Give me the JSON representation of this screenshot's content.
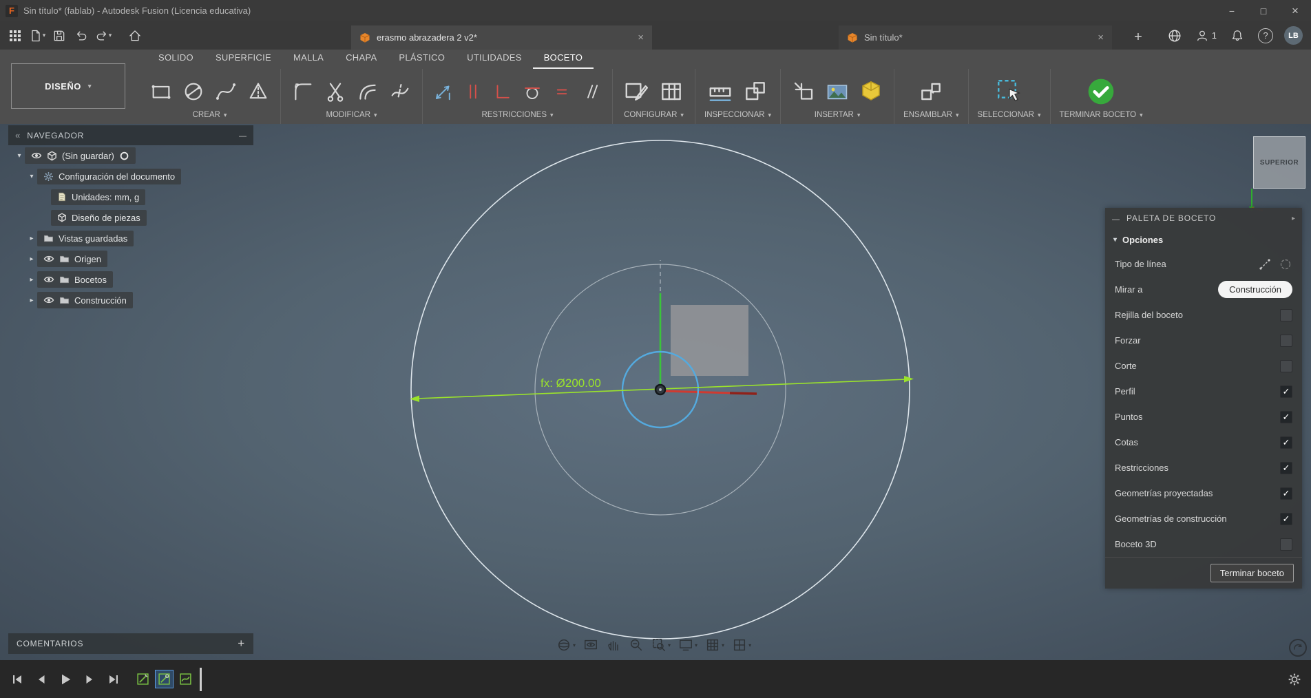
{
  "title_bar": {
    "logo_letter": "F",
    "title": "Sin título* (fablab) - Autodesk Fusion (Licencia educativa)"
  },
  "toolbar": {
    "document_tabs": [
      {
        "label": "erasmo abrazadera 2 v2*",
        "active": true
      },
      {
        "label": "Sin título*",
        "active": false
      }
    ],
    "notification_count": "1",
    "avatar_initials": "LB"
  },
  "ribbon": {
    "workspace_label": "DISEÑO",
    "tabs": [
      {
        "label": "SOLIDO",
        "active": false
      },
      {
        "label": "SUPERFICIE",
        "active": false
      },
      {
        "label": "MALLA",
        "active": false
      },
      {
        "label": "CHAPA",
        "active": false
      },
      {
        "label": "PLÁSTICO",
        "active": false
      },
      {
        "label": "UTILIDADES",
        "active": false
      },
      {
        "label": "BOCETO",
        "active": true
      }
    ],
    "groups": [
      {
        "label": "CREAR"
      },
      {
        "label": "MODIFICAR"
      },
      {
        "label": "RESTRICCIONES"
      },
      {
        "label": "CONFIGURAR"
      },
      {
        "label": "INSPECCIONAR"
      },
      {
        "label": "INSERTAR"
      },
      {
        "label": "ENSAMBLAR"
      },
      {
        "label": "SELECCIONAR"
      },
      {
        "label": "TERMINAR BOCETO"
      }
    ]
  },
  "navigator": {
    "header": "NAVEGADOR",
    "items": [
      {
        "label": "(Sin guardar)"
      },
      {
        "label": "Configuración del documento"
      },
      {
        "label": "Unidades: mm, g"
      },
      {
        "label": "Diseño de piezas"
      },
      {
        "label": "Vistas guardadas"
      },
      {
        "label": "Origen"
      },
      {
        "label": "Bocetos"
      },
      {
        "label": "Construcción"
      }
    ]
  },
  "canvas": {
    "dimension_label": "fx: Ø200.00",
    "viewcube_face": "SUPERIOR"
  },
  "palette": {
    "header": "PALETA DE BOCETO",
    "section_label": "Opciones",
    "rows": [
      {
        "label": "Tipo de línea"
      },
      {
        "label": "Mirar a",
        "button_label": "Construcción"
      },
      {
        "label": "Rejilla del boceto",
        "checked": false
      },
      {
        "label": "Forzar",
        "checked": false
      },
      {
        "label": "Corte",
        "checked": false
      },
      {
        "label": "Perfil",
        "checked": true
      },
      {
        "label": "Puntos",
        "checked": true
      },
      {
        "label": "Cotas",
        "checked": true
      },
      {
        "label": "Restricciones",
        "checked": true
      },
      {
        "label": "Geometrías proyectadas",
        "checked": true
      },
      {
        "label": "Geometrías de construcción",
        "checked": true
      },
      {
        "label": "Boceto 3D",
        "checked": false
      }
    ],
    "finish_button_label": "Terminar boceto"
  },
  "comments": {
    "label": "COMENTARIOS"
  },
  "colors": {
    "dimension_green": "#9be32b",
    "axis_green": "#3bc43b",
    "axis_red": "#d03a30",
    "selection_blue": "#54aadf",
    "finish_green": "#37a93c",
    "canvas_center": "#5f7080",
    "canvas_edge": "#3f4b57"
  }
}
